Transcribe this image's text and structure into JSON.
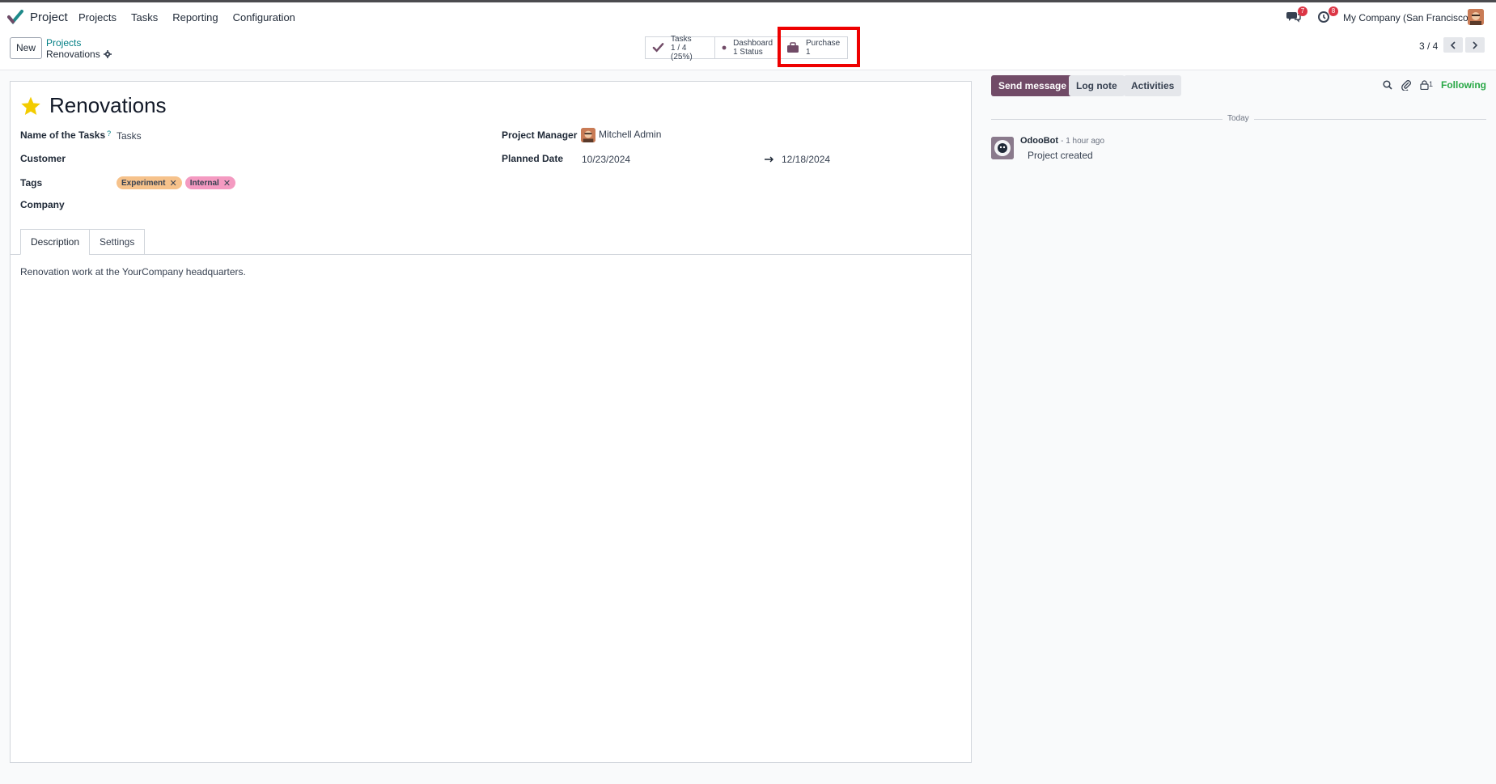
{
  "navbar": {
    "app_name": "Project",
    "menu": [
      "Projects",
      "Tasks",
      "Reporting",
      "Configuration"
    ],
    "messages_count": "7",
    "activities_count": "8",
    "company": "My Company (San Francisco)"
  },
  "control": {
    "new_label": "New",
    "breadcrumb_parent": "Projects",
    "breadcrumb_current": "Renovations",
    "pager": "3 / 4"
  },
  "smart_buttons": {
    "tasks": {
      "label": "Tasks",
      "value": "1 / 4 (25%)"
    },
    "dashboard": {
      "label": "Dashboard",
      "value": "1 Status"
    },
    "purchase": {
      "label": "Purchase",
      "value": "1"
    }
  },
  "form": {
    "title": "Renovations",
    "name_of_tasks_label": "Name of the Tasks",
    "name_of_tasks_help": "?",
    "name_of_tasks_value": "Tasks",
    "customer_label": "Customer",
    "tags_label": "Tags",
    "tags": [
      {
        "name": "Experiment",
        "color": "#f6c28b"
      },
      {
        "name": "Internal",
        "color": "#f49ac1"
      }
    ],
    "company_label": "Company",
    "project_manager_label": "Project Manager",
    "project_manager_value": "Mitchell Admin",
    "planned_date_label": "Planned Date",
    "planned_date_start": "10/23/2024",
    "planned_date_end": "12/18/2024",
    "tabs": [
      "Description",
      "Settings"
    ],
    "description": "Renovation work at the YourCompany headquarters."
  },
  "chatter": {
    "send_message": "Send message",
    "log_note": "Log note",
    "activities": "Activities",
    "followers_count": "1",
    "following": "Following",
    "day_separator": "Today",
    "messages": [
      {
        "author": "OdooBot",
        "time": "- 1 hour ago",
        "body": "Project created"
      }
    ]
  },
  "colors": {
    "primary": "#714b67",
    "accent": "#017e84",
    "highlight": "#ee0000",
    "following": "#28a745"
  }
}
